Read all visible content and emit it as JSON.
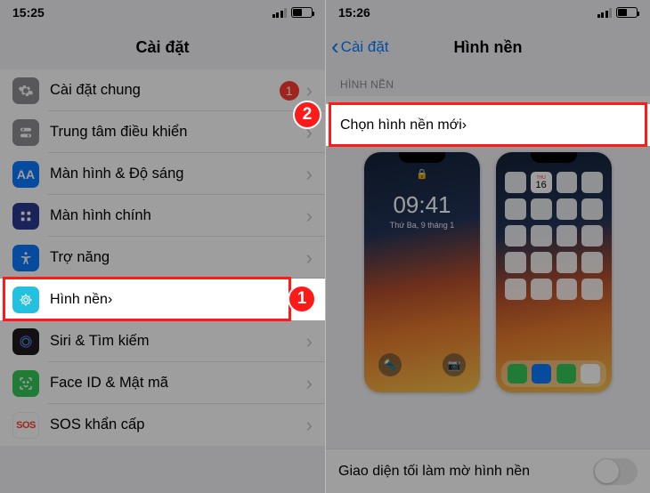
{
  "left": {
    "statusTime": "15:25",
    "title": "Cài đặt",
    "items": [
      {
        "label": "Cài đặt chung",
        "badge": "1"
      },
      {
        "label": "Trung tâm điều khiển"
      },
      {
        "label": "Màn hình & Độ sáng"
      },
      {
        "label": "Màn hình chính"
      },
      {
        "label": "Trợ năng"
      },
      {
        "label": "Hình nền"
      },
      {
        "label": "Siri & Tìm kiếm"
      },
      {
        "label": "Face ID & Mật mã"
      },
      {
        "label": "SOS khẩn cấp"
      }
    ]
  },
  "right": {
    "statusTime": "15:26",
    "back": "Cài đặt",
    "title": "Hình nền",
    "sectionLabel": "HÌNH NỀN",
    "chooseNew": "Chọn hình nền mới",
    "lockTime": "09:41",
    "lockDate": "Thứ Ba, 9 tháng 1",
    "calDay": "16",
    "toggleLabel": "Giao diện tối làm mờ hình nền"
  },
  "steps": {
    "one": "1",
    "two": "2"
  }
}
